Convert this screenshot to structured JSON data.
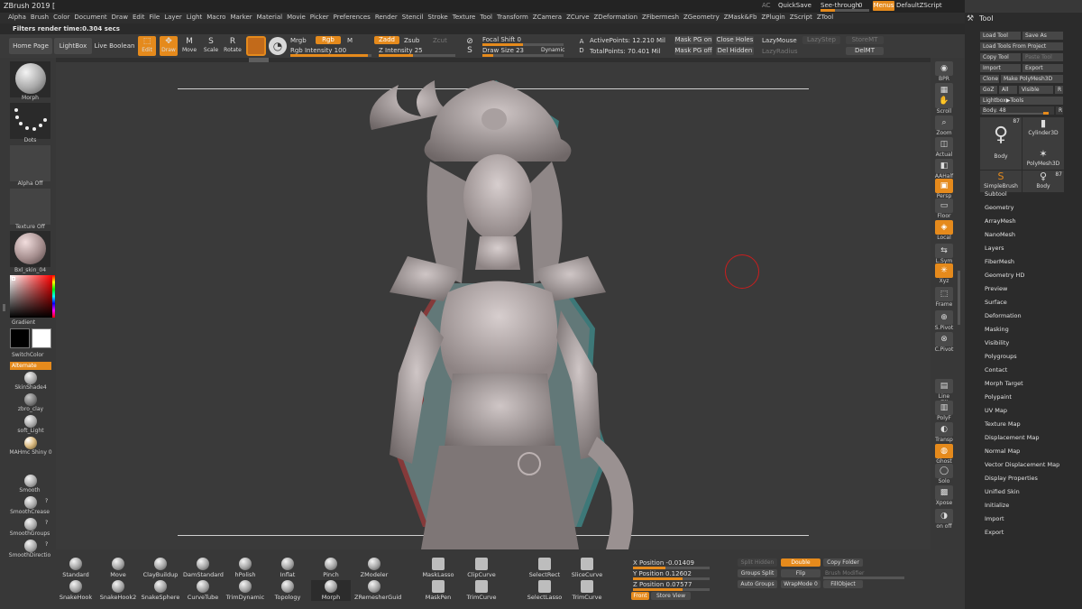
{
  "app_title": "ZBrush 2019 [",
  "menus": [
    "Alpha",
    "Brush",
    "Color",
    "Document",
    "Draw",
    "Edit",
    "File",
    "Layer",
    "Light",
    "Macro",
    "Marker",
    "Material",
    "Movie",
    "Picker",
    "Preferences",
    "Render",
    "Stencil",
    "Stroke",
    "Texture",
    "Tool",
    "Transform",
    "ZCamera",
    "ZCurve",
    "ZDeformation",
    "ZFibermesh",
    "ZGeometry",
    "ZMask&Fb",
    "ZPlugin",
    "ZScript",
    "ZTool"
  ],
  "title_right": {
    "ac": "AC",
    "quicksave": "QuickSave",
    "see_through_label": "See-through",
    "see_through_value": "0",
    "menus_btn": "Menus",
    "default_script": "DefaultZScript"
  },
  "status_text": "Filters render time:0.304 secs",
  "shelf": {
    "home_page": "Home Page",
    "lightbox": "LightBox",
    "live_boolean": "Live Boolean",
    "edit": "Edit",
    "draw": "Draw",
    "move": "Move",
    "scale": "Scale",
    "rotate": "Rotate",
    "mrgb": "Mrgb",
    "rgb": "Rgb",
    "m": "M",
    "rgb_intensity": "Rgb Intensity 100",
    "zadd": "Zadd",
    "zsub": "Zsub",
    "zcut": "Zcut",
    "z_intensity": "Z Intensity 25",
    "focal_shift": "Focal Shift 0",
    "draw_size": "Draw Size 23",
    "dynamic": "Dynamic",
    "active_points": "ActivePoints: 12.210 Mil",
    "total_points": "TotalPoints: 70.401 Mil",
    "mask_pg_on": "Mask PG on",
    "close_holes": "Close Holes",
    "lazymouse": "LazyMouse",
    "lazystep": "LazyStep",
    "storemt": "StoreMT",
    "mask_pg_off": "Mask PG off",
    "del_hidden": "Del Hidden",
    "lazyradius": "LazyRadius",
    "delmt": "DelMT"
  },
  "left_shelf": {
    "brush_label": "Morph",
    "stroke_label": "Dots",
    "alpha_label": "Alpha Off",
    "texture_label": "Texture Off",
    "material_label": "Bxl_skin_04",
    "gradient_label": "Gradient",
    "switch_color": "SwitchColor",
    "alternate": "Alternate",
    "materials": [
      "SkinShade4",
      "zbro_clay",
      "soft_Light",
      "MAHmc Shiny 0"
    ],
    "smooth_brushes": [
      "Smooth",
      "SmoothCrease",
      "SmoothGroups",
      "SmoothDirectio"
    ],
    "q_mark": "?"
  },
  "right_tray": [
    {
      "label": "BPR",
      "icon": "bpr-icon"
    },
    {
      "label": "SPix 3",
      "icon": "spix-icon"
    },
    {
      "label": "Scroll",
      "icon": "hand-icon"
    },
    {
      "label": "Zoom",
      "icon": "zoom-icon"
    },
    {
      "label": "Actual",
      "icon": "actual-icon"
    },
    {
      "label": "AAHalf",
      "icon": "aahalf-icon"
    },
    {
      "label": "Persp",
      "icon": "persp-icon"
    },
    {
      "label": "Floor",
      "icon": "floor-icon"
    },
    {
      "label": "Local",
      "icon": "local-icon"
    },
    {
      "label": "L.Sym",
      "icon": "lsym-icon"
    },
    {
      "label": "Xyz",
      "icon": "xyz-icon"
    },
    {
      "label": "Frame",
      "icon": "frame-icon"
    },
    {
      "label": "S.Pivot",
      "icon": "pivot-icon"
    },
    {
      "label": "C.Pivot",
      "icon": "cpivot-icon"
    },
    {
      "label": "Line Fill",
      "icon": "linefill-icon"
    },
    {
      "label": "PolyF",
      "icon": "polyf-icon"
    },
    {
      "label": "Transp",
      "icon": "transp-icon"
    },
    {
      "label": "Ghost",
      "icon": "ghost-icon"
    },
    {
      "label": "Solo",
      "icon": "solo-icon"
    },
    {
      "label": "Xpose",
      "icon": "xpose-icon"
    },
    {
      "label": "on off",
      "icon": "toggle-icon"
    }
  ],
  "tool_palette": {
    "title": "Tool",
    "load_tool": "Load Tool",
    "save_as": "Save As",
    "load_tools_from_project": "Load Tools From Project",
    "copy_tool": "Copy Tool",
    "paste_tool": "Paste Tool",
    "import": "Import",
    "export": "Export",
    "clone": "Clone",
    "make_polymesh": "Make PolyMesh3D",
    "goz": "GoZ",
    "all": "All",
    "visible": "Visible",
    "r": "R",
    "lightbox_tools": "Lightbox▶Tools",
    "body_slider": "Body. 48",
    "thumbs": [
      {
        "label": "Body",
        "count": "87"
      },
      {
        "label": "Cylinder3D"
      },
      {
        "label": "PolyMesh3D"
      },
      {
        "label": "SimpleBrush"
      },
      {
        "label": "Body",
        "count": "87"
      }
    ],
    "sections": [
      "Subtool",
      "Geometry",
      "ArrayMesh",
      "NanoMesh",
      "Layers",
      "FiberMesh",
      "Geometry HD",
      "Preview",
      "Surface",
      "Deformation",
      "Masking",
      "Visibility",
      "Polygroups",
      "Contact",
      "Morph Target",
      "Polypaint",
      "UV Map",
      "Texture Map",
      "Displacement Map",
      "Normal Map",
      "Vector Displacement Map",
      "Display Properties",
      "Unified Skin",
      "Initialize",
      "Import",
      "Export"
    ]
  },
  "bottom_shelf": {
    "brushes_row1": [
      "Standard",
      "Move",
      "ClayBuildup",
      "DamStandard",
      "hPolish",
      "Inflat",
      "Pinch",
      "ZModeler"
    ],
    "brushes_row2": [
      "SnakeHook",
      "SnakeHook2",
      "SnakeSphere",
      "CurveTube",
      "TrimDynamic",
      "Topology",
      "Morph",
      "ZRemesherGuid"
    ],
    "mask_row1": [
      "MaskLasso",
      "ClipCurve",
      "SelectRect",
      "SliceCurve"
    ],
    "mask_row2": [
      "MaskPen",
      "TrimCurve",
      "SelectLasso",
      "TrimCurve"
    ],
    "x_position": "X Position -0.01409",
    "y_position": "Y Position 0.12602",
    "z_position": "Z Position 0.07577",
    "front": "Front",
    "store_view": "Store View",
    "split_hidden": "Split Hidden",
    "double": "Double",
    "copy_folder": "Copy Folder",
    "groups_split": "Groups Split",
    "flip": "Flip",
    "brush_modifier": "Brush Modifier",
    "auto_groups": "Auto Groups",
    "wrapmode": "WrapMode 0",
    "fillobject": "FillObject"
  },
  "colors": {
    "accent": "#e58a1c",
    "panel": "#383838",
    "dark": "#2b2b2b"
  }
}
